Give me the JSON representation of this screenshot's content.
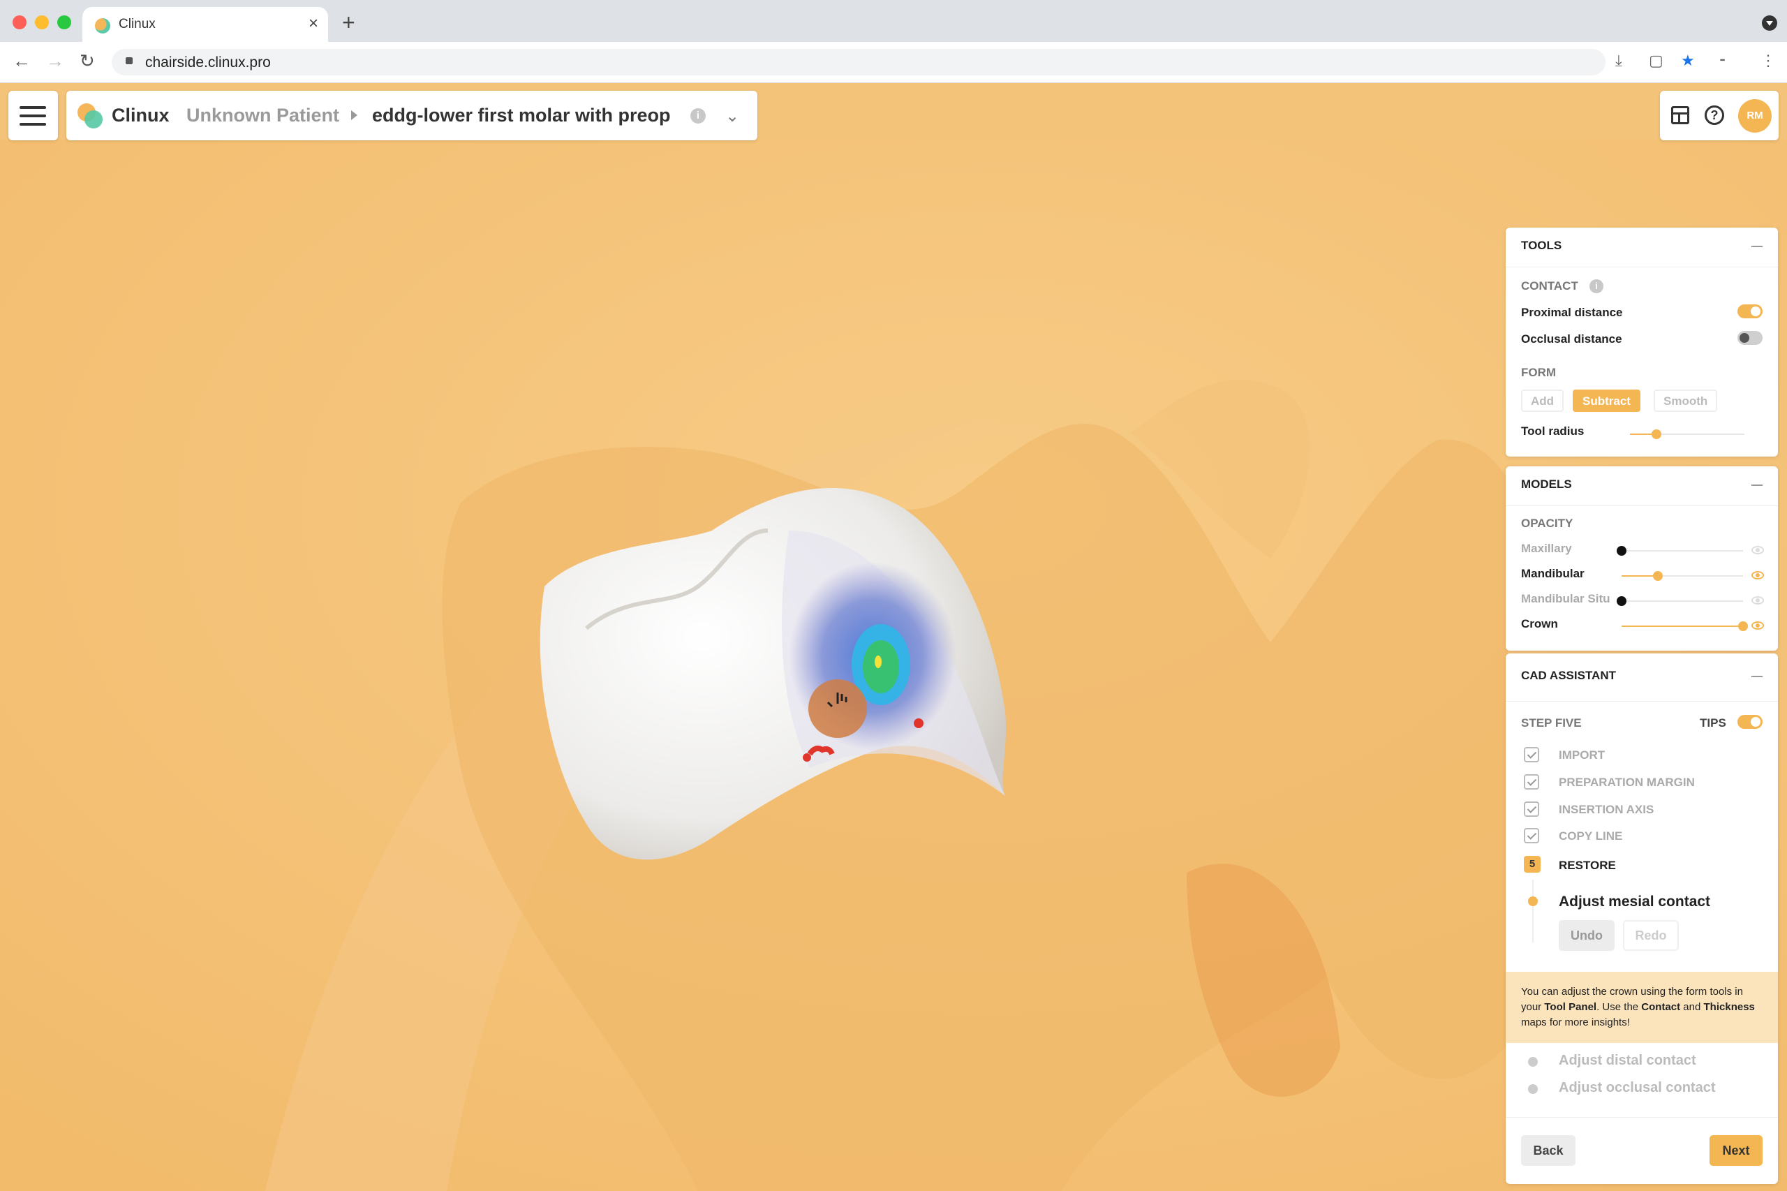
{
  "browser": {
    "tab_title": "Clinux",
    "url": "chairside.clinux.pro"
  },
  "header": {
    "brand": "Clinux",
    "patient": "Unknown Patient",
    "case_name": "eddg-lower first molar with preop",
    "info_glyph": "i",
    "avatar_initials": "RM",
    "help_glyph": "?"
  },
  "tools": {
    "title": "TOOLS",
    "contact_label": "CONTACT",
    "contact_info_glyph": "i",
    "proximal_label": "Proximal distance",
    "proximal_on": true,
    "occlusal_label": "Occlusal distance",
    "occlusal_on": false,
    "form_label": "FORM",
    "form_buttons": [
      "Add",
      "Subtract",
      "Smooth"
    ],
    "form_active": "Subtract",
    "tool_radius_label": "Tool radius",
    "tool_radius_value": 0.23
  },
  "models": {
    "title": "MODELS",
    "opacity_label": "OPACITY",
    "items": [
      {
        "label": "Maxillary",
        "opacity": 0.0,
        "visible": false
      },
      {
        "label": "Mandibular",
        "opacity": 0.3,
        "visible": true
      },
      {
        "label": "Mandibular Situ",
        "opacity": 0.0,
        "visible": false
      },
      {
        "label": "Crown",
        "opacity": 1.0,
        "visible": true
      }
    ]
  },
  "assistant": {
    "title": "CAD ASSISTANT",
    "step_label": "STEP FIVE",
    "tips_label": "TIPS",
    "tips_on": true,
    "completed_steps": [
      "IMPORT",
      "PREPARATION MARGIN",
      "INSERTION AXIS",
      "COPY LINE"
    ],
    "current_step_number": "5",
    "current_step": "RESTORE",
    "active_substep": "Adjust mesial contact",
    "undo_label": "Undo",
    "redo_label": "Redo",
    "tip": {
      "t1": "You can adjust the crown using the form tools in your ",
      "b1": "Tool Panel",
      "t2": ". Use the ",
      "b2": "Contact",
      "t3": " and ",
      "b3": "Thickness",
      "t4": " maps for more insights!"
    },
    "pending_substeps": [
      "Adjust distal contact",
      "Adjust occlusal contact"
    ],
    "back_label": "Back",
    "next_label": "Next"
  },
  "colors": {
    "accent": "#f4b652",
    "background": "#f4c37a"
  }
}
